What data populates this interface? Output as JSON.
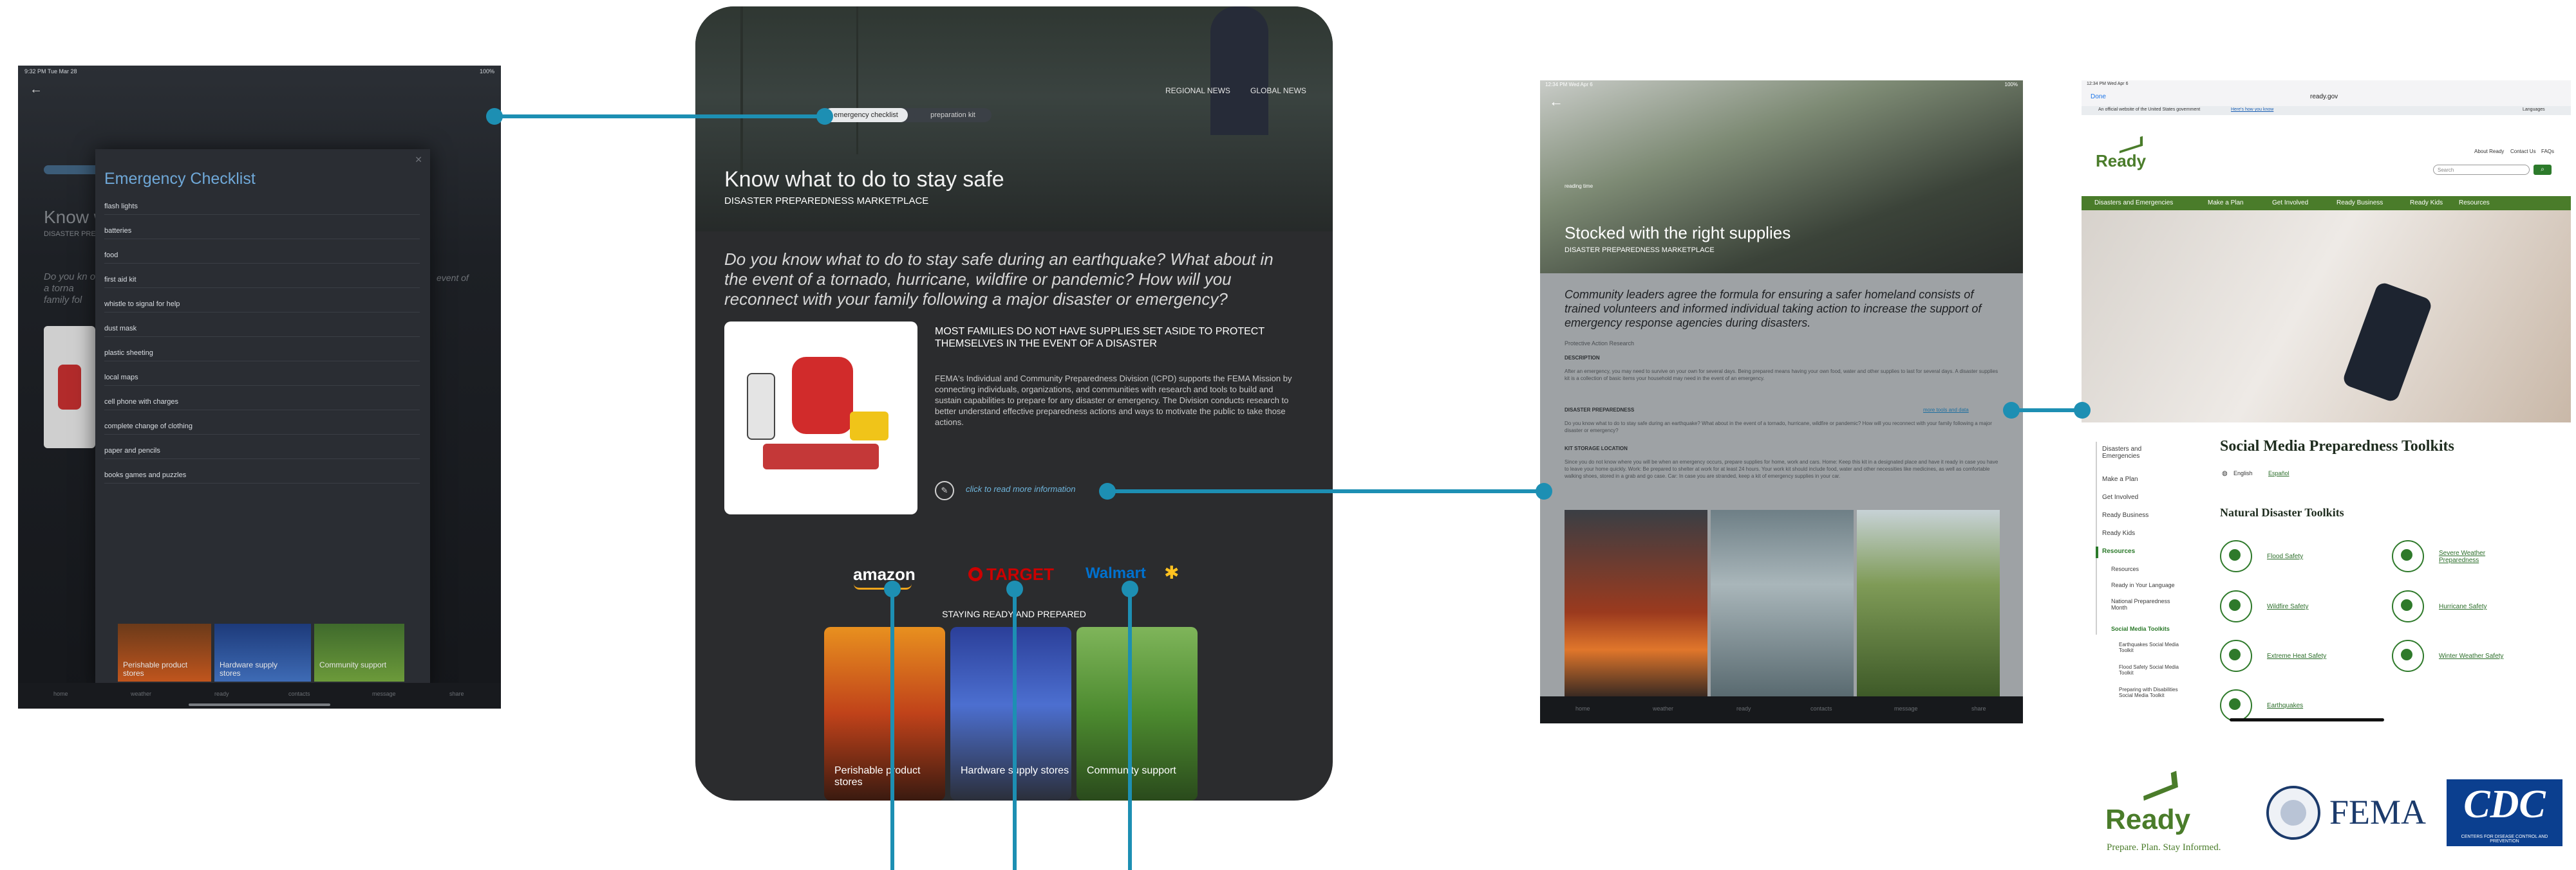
{
  "left_screen": {
    "status_time": "9:32 PM  Tue Mar 28",
    "status_battery": "100%",
    "checklist_title": "Emergency Checklist",
    "checklist_items": [
      "flash lights",
      "batteries",
      "food",
      "first aid kit",
      "whistle to signal for help",
      "dust mask",
      "plastic sheeting",
      "local maps",
      "cell phone with charges",
      "complete change of clothing",
      "paper and pencils",
      "books games and puzzles"
    ],
    "bg_heading": "Know w",
    "bg_sub": "DISASTER PRE",
    "bg_quote": "Do you kn of a torna family fol",
    "bg_right_text": "event of",
    "bg_tiles": [
      "Perishable product stores",
      "Hardware supply stores",
      "Community support"
    ],
    "bottom_tabs": [
      "home",
      "weather",
      "ready",
      "contacts",
      "message",
      "share"
    ]
  },
  "center_screen": {
    "tab_active": "emergency checklist",
    "tab_other": "preparation kit",
    "news_regional": "REGIONAL NEWS",
    "news_global": "GLOBAL NEWS",
    "title": "Know what to do to stay safe",
    "subtitle": "DISASTER PREPAREDNESS MARKETPLACE",
    "quote": "Do you know what to do to stay safe during an earthquake? What about in the event of a tornado, hurricane, wildfire or pandemic? How will you reconnect with your family following a major disaster or emergency?",
    "heading": "MOST FAMILIES DO NOT HAVE SUPPLIES SET ASIDE TO PROTECT THEMSELVES IN THE EVENT OF A DISASTER",
    "body": "FEMA's Individual and Community Preparedness Division (ICPD) supports the FEMA Mission by connecting individuals, organizations, and communities with research and tools to build and sustain capabilities to prepare for any disaster or emergency. The Division conducts research to better understand effective preparedness actions and ways to motivate the public to take those actions.",
    "read_more": "click to read more information",
    "brands": {
      "amazon": "amazon",
      "target": "TARGET",
      "walmart": "Walmart"
    },
    "staying_ready": "STAYING READY AND PREPARED",
    "tiles": [
      {
        "label": "Perishable product stores"
      },
      {
        "label": "Hardware supply stores"
      },
      {
        "label": "Community support"
      }
    ]
  },
  "right_screen": {
    "status_time": "12:34 PM  Wed Apr 6",
    "status_battery": "100%",
    "tag": "reading time",
    "title": "Stocked with the right supplies",
    "subtitle": "DISASTER PREPAREDNESS MARKETPLACE",
    "quote": "Community leaders agree the formula for ensuring a safer homeland consists of trained volunteers and informed individual taking action to increase the support of emergency response agencies during disasters.",
    "author": "Protective Action Research",
    "section_description": "DESCRIPTION",
    "description_text": "After an emergency, you may need to survive on your own for several days. Being prepared means having your own food, water and other supplies to last for several days. A disaster supplies kit is a collection of basic items your household may need in the event of an emergency.",
    "section_preparedness": "DISASTER PREPAREDNESS",
    "link_text": "more tools and data",
    "preparedness_text": "Do you know what to do to stay safe during an earthquake? What about in the event of a tornado, hurricane, wildfire or pandemic? How will you reconnect with your family following a major disaster or emergency?",
    "section_storage": "KIT STORAGE LOCATION",
    "storage_text": "Since you do not know where you will be when an emergency occurs, prepare supplies for home, work and cars. Home: Keep this kit in a designated place and have it ready in case you have to leave your home quickly. Work: Be prepared to shelter at work for at least 24 hours. Your work kit should include food, water and other necessities like medicines, as well as comfortable walking shoes, stored in a grab and go case. Car: In case you are stranded, keep a kit of emergency supplies in your car.",
    "bottom_tabs": [
      "home",
      "weather",
      "ready",
      "contacts",
      "message",
      "share"
    ]
  },
  "readygov": {
    "status_time": "12:34 PM  Wed Apr 6",
    "toolbar_done": "Done",
    "url": "ready.gov",
    "gov_banner": "An official website of the United States government",
    "gov_banner_link": "Here's how you know",
    "language": "Languages",
    "top_links": [
      "About Ready",
      "Contact Us",
      "FAQs"
    ],
    "logo": "Ready",
    "search_placeholder": "Search",
    "nav": [
      "Disasters and Emergencies",
      "Make a Plan",
      "Get Involved",
      "Ready Business",
      "Ready Kids",
      "Resources"
    ],
    "sidebar": [
      "Disasters and Emergencies",
      "Make a Plan",
      "Get Involved",
      "Ready Business",
      "Ready Kids",
      "Resources",
      "Resources",
      "Ready in Your Language",
      "National Preparedness Month",
      "Social Media Toolkits",
      "Earthquakes Social Media Toolkit",
      "Flood Safety Social Media Toolkit",
      "Preparing with Disabilities Social Media Toolkit"
    ],
    "page_title": "Social Media Preparedness Toolkits",
    "lang_english": "English",
    "lang_espanol": "Español",
    "section_title": "Natural Disaster Toolkits",
    "toolkits": [
      "Flood Safety",
      "Severe Weather Preparedness",
      "Wildfire Safety",
      "Hurricane Safety",
      "Extreme Heat Safety",
      "Winter Weather Safety",
      "Earthquakes"
    ]
  },
  "logos": {
    "ready": "Ready",
    "ready_tagline": "Prepare. Plan. Stay Informed.",
    "fema": "FEMA",
    "cdc": "CDC",
    "cdc_sub": "CENTERS FOR DISEASE CONTROL AND PREVENTION"
  },
  "colors": {
    "connector": "#1d8fb3",
    "ready_green": "#4a7c2a",
    "cdc_blue": "#0b3f8f",
    "fema_blue": "#1b3a6b",
    "target_red": "#cc0000",
    "walmart_blue": "#0071ce",
    "walmart_spark": "#ffc220"
  }
}
